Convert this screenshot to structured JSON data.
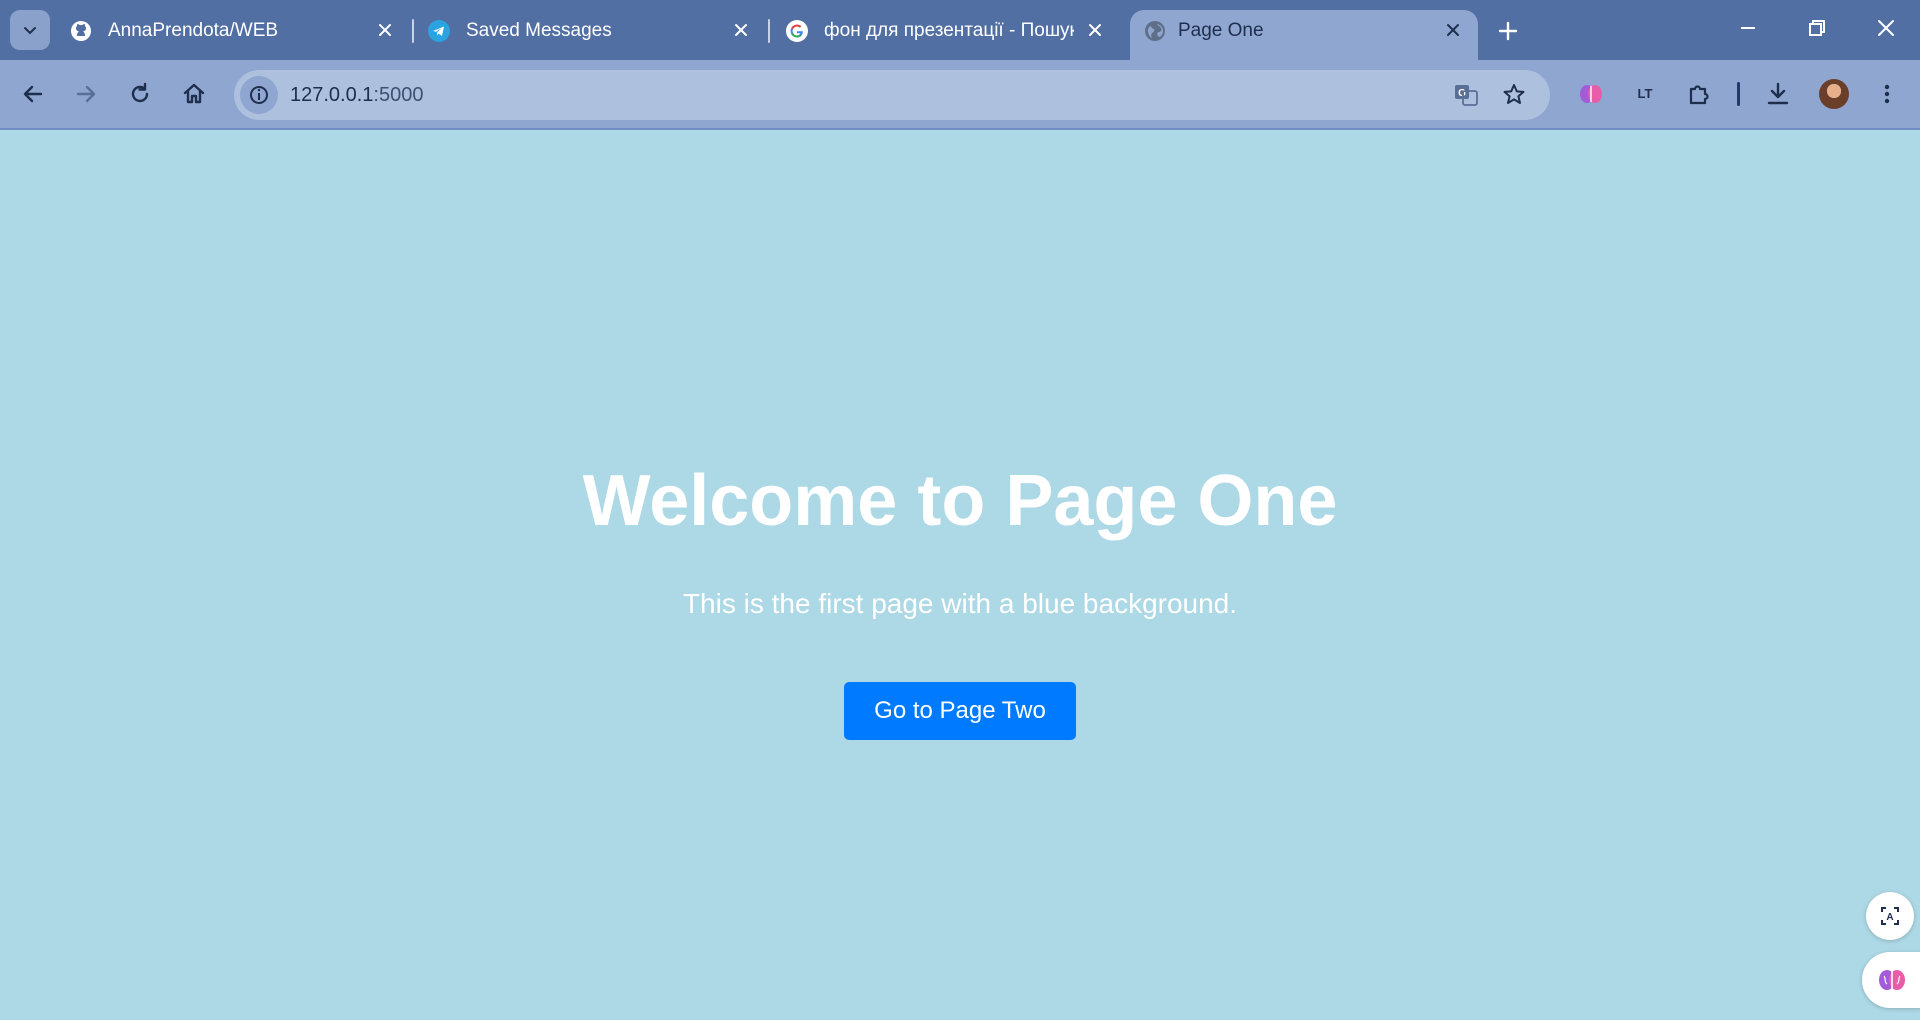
{
  "browser": {
    "tabs": [
      {
        "title": "AnnaPrendota/WEB",
        "favicon": "github-icon",
        "active": false
      },
      {
        "title": "Saved Messages",
        "favicon": "telegram-icon",
        "active": false
      },
      {
        "title": "фон для презентації - Пошук G",
        "favicon": "google-icon",
        "active": false
      },
      {
        "title": "Page One",
        "favicon": "globe-icon",
        "active": true
      }
    ],
    "address": {
      "host": "127.0.0.1",
      "port": ":5000"
    },
    "colors": {
      "tabstrip": "#516fa3",
      "toolbar": "#8ea6d0",
      "omnibox": "#adc0de"
    }
  },
  "page": {
    "background": "#add8e6",
    "heading": "Welcome to Page One",
    "subtitle": "This is the first page with a blue background.",
    "button_label": "Go to Page Two",
    "button_color": "#007bff"
  }
}
